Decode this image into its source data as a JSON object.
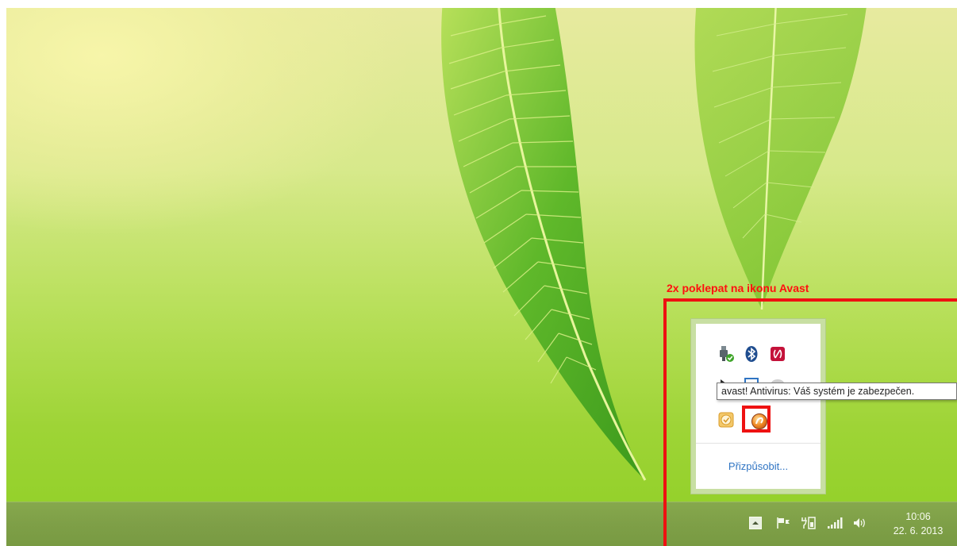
{
  "annotation": {
    "label": "2x poklepat na ikonu Avast",
    "color": "#ee1111"
  },
  "tray_popup": {
    "icons": [
      {
        "name": "safely-remove-hardware-icon"
      },
      {
        "name": "bluetooth-icon"
      },
      {
        "name": "red-app-icon"
      },
      {
        "name": "hidden-tray-icon"
      },
      {
        "name": "hidden-window-icon"
      },
      {
        "name": "hidden-tray-icon-2"
      },
      {
        "name": "clock-app-icon"
      },
      {
        "name": "avast-icon"
      }
    ],
    "customize_label": "Přizpůsobit..."
  },
  "tooltip": {
    "text": "avast! Antivirus: Váš systém je zabezpečen."
  },
  "taskbar": {
    "tray_icons": [
      {
        "name": "show-hidden-icons-icon"
      },
      {
        "name": "action-center-flag-icon"
      },
      {
        "name": "power-battery-icon"
      },
      {
        "name": "network-signal-icon"
      },
      {
        "name": "volume-icon"
      }
    ],
    "clock": {
      "time": "10:06",
      "date": "22. 6. 2013"
    }
  },
  "colors": {
    "accent_link": "#2f74c3",
    "annotation_red": "#ee1111",
    "taskbar": "#7e9f47"
  }
}
